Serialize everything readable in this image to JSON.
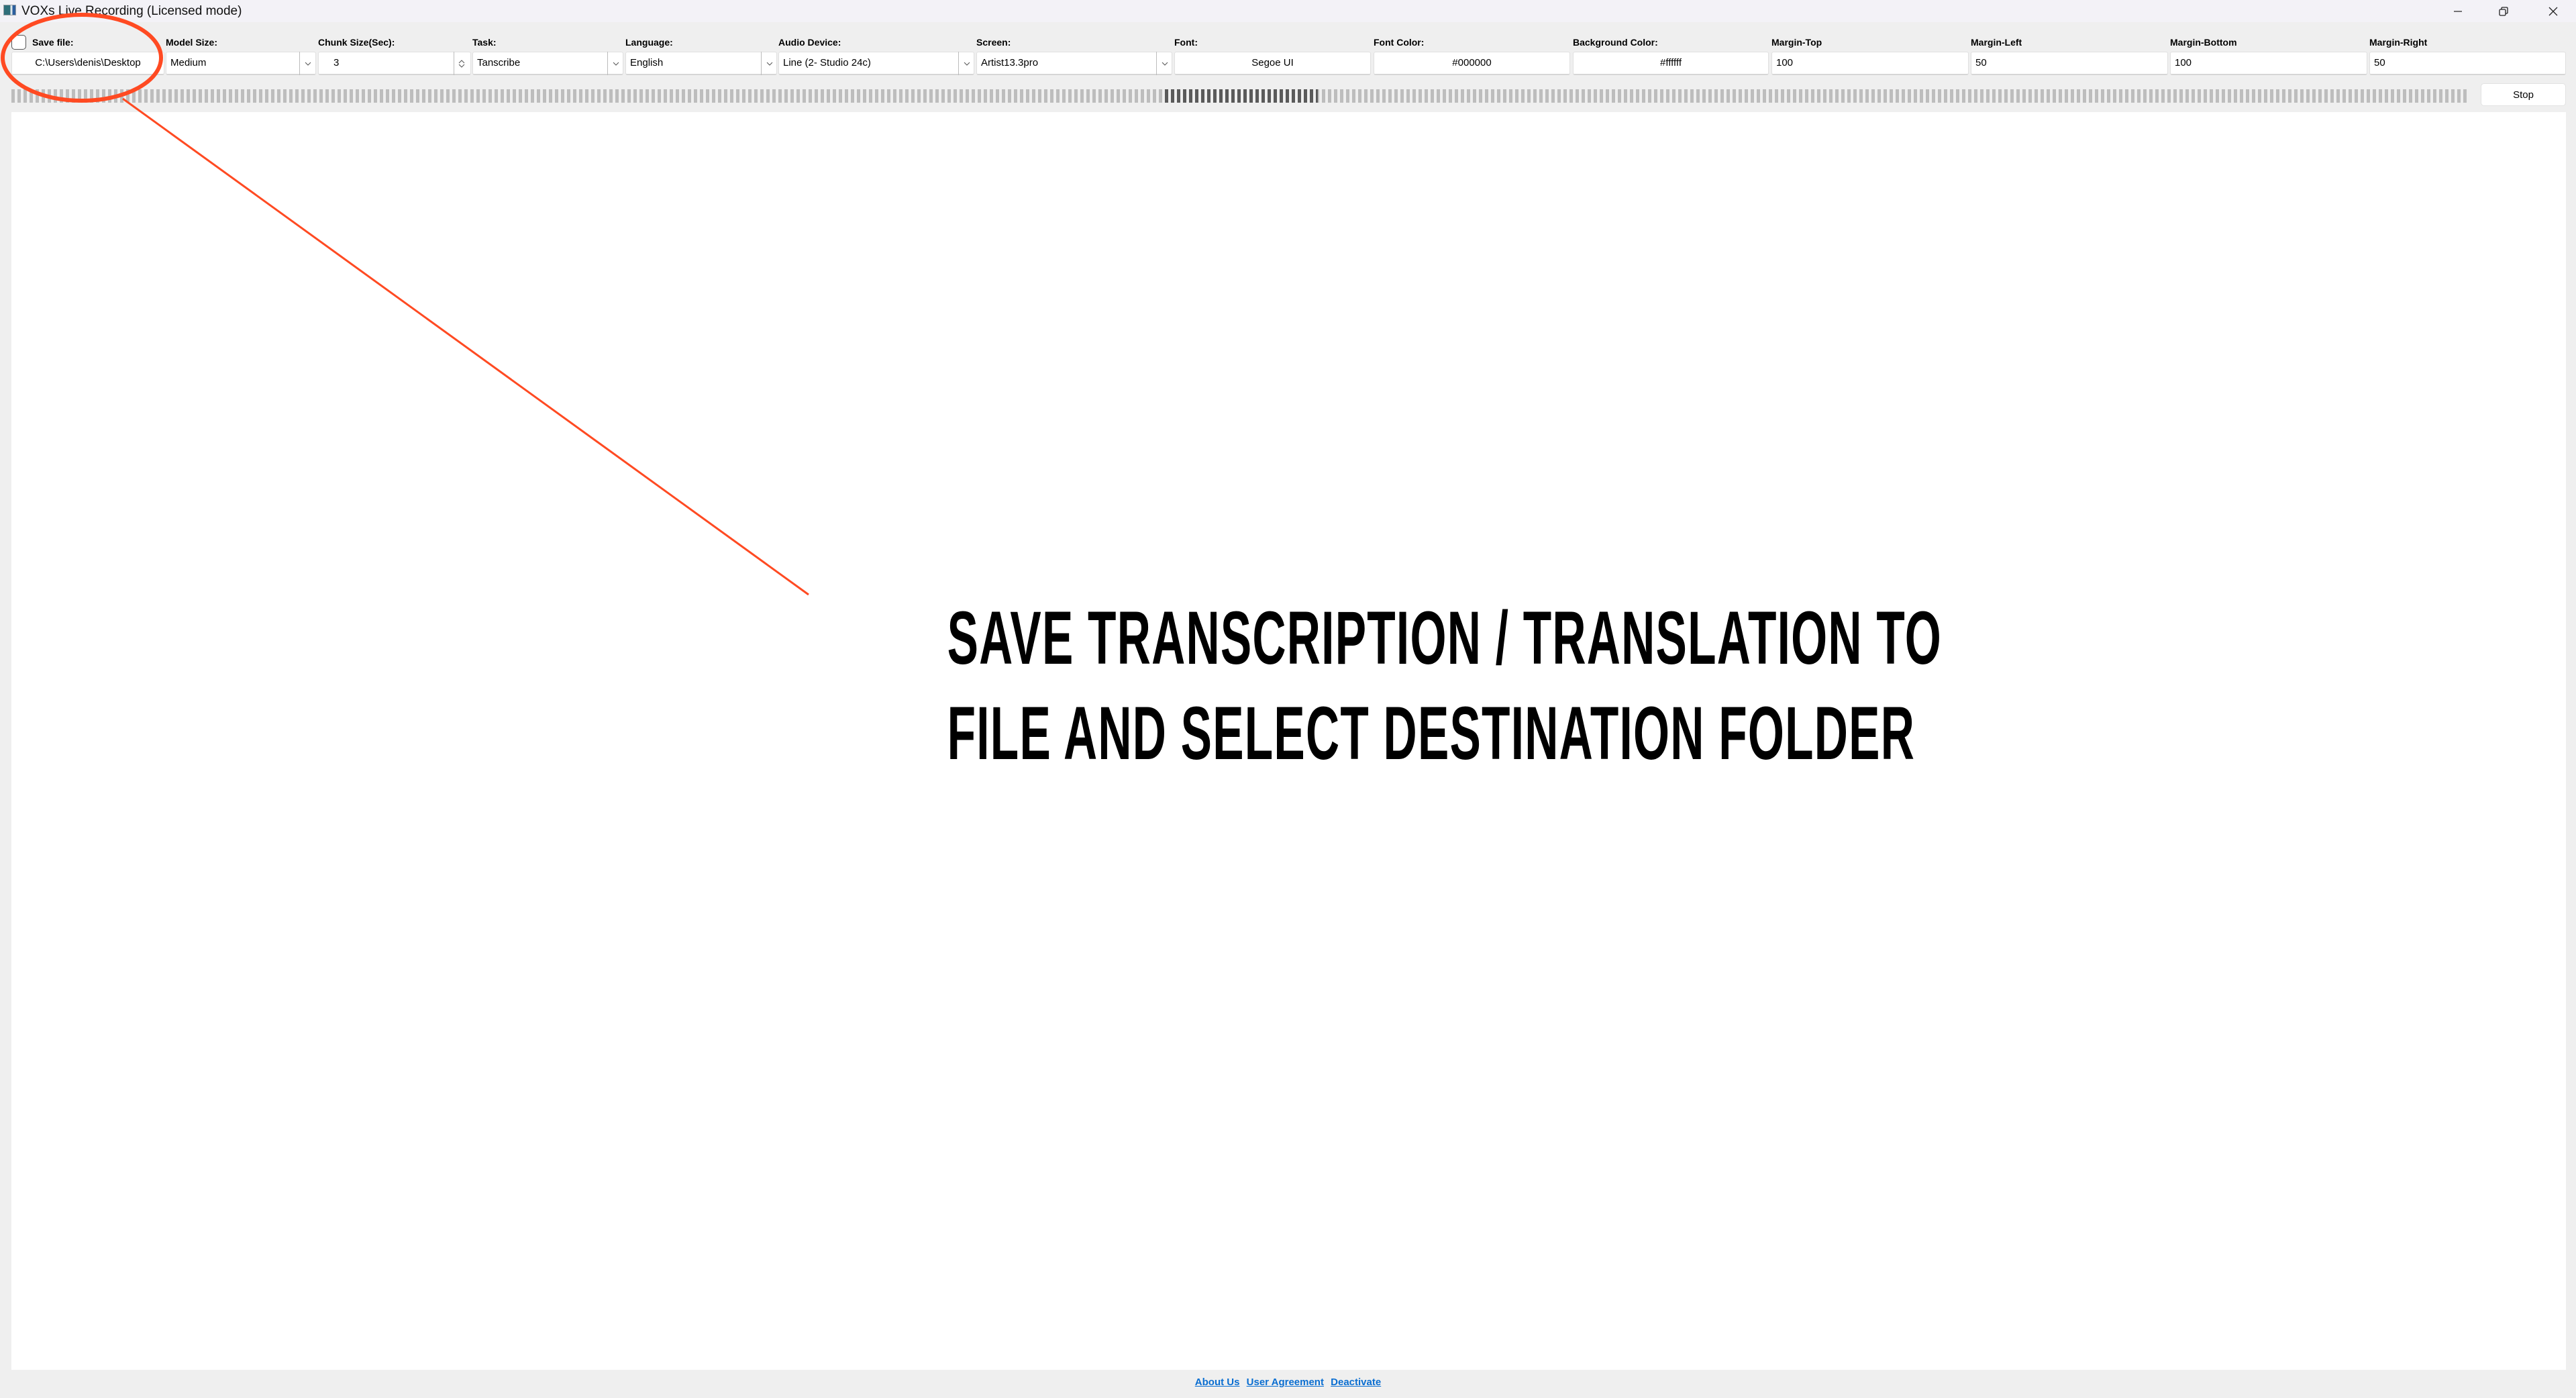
{
  "window": {
    "title": "VOXs Live Recording (Licensed mode)",
    "app_icon": "app-icon",
    "controls": [
      "minimize-icon",
      "restore-icon",
      "close-icon"
    ]
  },
  "toolbar": {
    "save_file": {
      "label": "Save file:",
      "checked": false,
      "value": "C:\\Users\\denis\\Desktop"
    },
    "model_size": {
      "label": "Model Size:",
      "value": "Medium"
    },
    "chunk_size": {
      "label": "Chunk Size(Sec):",
      "value": "3"
    },
    "task": {
      "label": "Task:",
      "value": "Tanscribe"
    },
    "language": {
      "label": "Language:",
      "value": "English"
    },
    "audio_device": {
      "label": "Audio Device:",
      "value": "Line (2- Studio 24c)"
    },
    "screen": {
      "label": "Screen:",
      "value": "Artist13.3pro"
    },
    "font": {
      "label": "Font:",
      "value": "Segoe UI"
    },
    "font_color": {
      "label": "Font Color:",
      "value": "#000000"
    },
    "background_color": {
      "label": "Background Color:",
      "value": "#ffffff"
    },
    "margin_top": {
      "label": "Margin-Top",
      "value": "100"
    },
    "margin_left": {
      "label": "Margin-Left",
      "value": "50"
    },
    "margin_bottom": {
      "label": "Margin-Bottom",
      "value": "100"
    },
    "margin_right": {
      "label": "Margin-Right",
      "value": "50"
    }
  },
  "progress": {
    "state": "indeterminate"
  },
  "stop_button": {
    "label": "Stop"
  },
  "footer": {
    "links": [
      "About Us",
      "User Agreement",
      "Deactivate"
    ]
  },
  "annotation": {
    "line1": "SAVE TRANSCRIPTION / TRANSLATION TO",
    "line2": "FILE AND SELECT DESTINATION FOLDER",
    "color": "#ff4a22"
  }
}
